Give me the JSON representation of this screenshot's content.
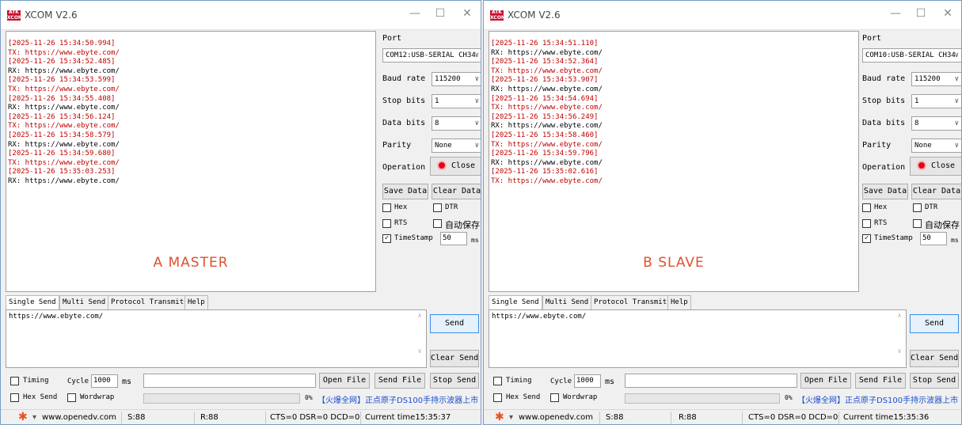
{
  "windows": [
    {
      "id": "A",
      "title": "XCOM V2.6",
      "logo_text": "ATK\nXCOM",
      "big_label": "A  MASTER",
      "log": [
        {
          "text": "[2025-11-26 15:34:50.994]",
          "color": "red"
        },
        {
          "text": "TX: https://www.ebyte.com/",
          "color": "red"
        },
        {
          "text": "[2025-11-26 15:34:52.485]",
          "color": "red"
        },
        {
          "text": "RX: https://www.ebyte.com/",
          "color": "black"
        },
        {
          "text": "[2025-11-26 15:34:53.599]",
          "color": "red"
        },
        {
          "text": "TX: https://www.ebyte.com/",
          "color": "red"
        },
        {
          "text": "[2025-11-26 15:34:55.408]",
          "color": "red"
        },
        {
          "text": "RX: https://www.ebyte.com/",
          "color": "black"
        },
        {
          "text": "[2025-11-26 15:34:56.124]",
          "color": "red"
        },
        {
          "text": "TX: https://www.ebyte.com/",
          "color": "red"
        },
        {
          "text": "[2025-11-26 15:34:58.579]",
          "color": "red"
        },
        {
          "text": "RX: https://www.ebyte.com/",
          "color": "black"
        },
        {
          "text": "[2025-11-26 15:34:59.680]",
          "color": "red"
        },
        {
          "text": "TX: https://www.ebyte.com/",
          "color": "red"
        },
        {
          "text": "[2025-11-26 15:35:03.253]",
          "color": "red"
        },
        {
          "text": "RX: https://www.ebyte.com/",
          "color": "black"
        }
      ],
      "port_label": "Port",
      "port_value": "COM12:USB-SERIAL CH34",
      "baud_label": "Baud rate",
      "baud_value": "115200",
      "stop_label": "Stop bits",
      "stop_value": "1",
      "data_label": "Data bits",
      "data_value": "8",
      "parity_label": "Parity",
      "parity_value": "None",
      "operation_label": "Operation",
      "operation_button": "Close",
      "save_data": "Save Data",
      "clear_data": "Clear Data",
      "hex_label": "Hex",
      "dtr_label": "DTR",
      "rts_label": "RTS",
      "autosave_label": "自动保存",
      "timestamp_label": "TimeStamp",
      "timestamp_checked": true,
      "timestamp_value": "50",
      "timestamp_unit": "ms",
      "tabs": [
        "Single Send",
        "Multi Send",
        "Protocol Transmit",
        "Help"
      ],
      "send_text": "https://www.ebyte.com/",
      "send_button": "Send",
      "clear_send": "Clear Send",
      "timing_label": "Timing",
      "cycle_label": "Cycle",
      "cycle_value": "1000",
      "cycle_unit": "ms",
      "open_file": "Open File",
      "send_file": "Send File",
      "stop_send": "Stop Send",
      "hex_send": "Hex Send",
      "wordwrap": "Wordwrap",
      "progress_text": "0%",
      "ad_text": "【火爆全网】正点原子DS100手持示波器上市",
      "status": {
        "url": "www.openedv.com",
        "s": "S:88",
        "r": "R:88",
        "lines": "CTS=0 DSR=0 DCD=0",
        "time": "Current time15:35:37"
      }
    },
    {
      "id": "B",
      "title": "XCOM V2.6",
      "logo_text": "ATK\nXCOM",
      "big_label": "B  SLAVE",
      "log": [
        {
          "text": "[2025-11-26 15:34:51.110]",
          "color": "red"
        },
        {
          "text": "RX: https://www.ebyte.com/",
          "color": "black"
        },
        {
          "text": "[2025-11-26 15:34:52.364]",
          "color": "red"
        },
        {
          "text": "TX: https://www.ebyte.com/",
          "color": "red"
        },
        {
          "text": "[2025-11-26 15:34:53.907]",
          "color": "red"
        },
        {
          "text": "RX: https://www.ebyte.com/",
          "color": "black"
        },
        {
          "text": "[2025-11-26 15:34:54.694]",
          "color": "red"
        },
        {
          "text": "TX: https://www.ebyte.com/",
          "color": "red"
        },
        {
          "text": "[2025-11-26 15:34:56.249]",
          "color": "red"
        },
        {
          "text": "RX: https://www.ebyte.com/",
          "color": "black"
        },
        {
          "text": "[2025-11-26 15:34:58.460]",
          "color": "red"
        },
        {
          "text": "TX: https://www.ebyte.com/",
          "color": "red"
        },
        {
          "text": "[2025-11-26 15:34:59.796]",
          "color": "red"
        },
        {
          "text": "RX: https://www.ebyte.com/",
          "color": "black"
        },
        {
          "text": "[2025-11-26 15:35:02.616]",
          "color": "red"
        },
        {
          "text": "TX: https://www.ebyte.com/",
          "color": "red"
        }
      ],
      "port_label": "Port",
      "port_value": "COM10:USB-SERIAL CH34",
      "baud_label": "Baud rate",
      "baud_value": "115200",
      "stop_label": "Stop bits",
      "stop_value": "1",
      "data_label": "Data bits",
      "data_value": "8",
      "parity_label": "Parity",
      "parity_value": "None",
      "operation_label": "Operation",
      "operation_button": "Close",
      "save_data": "Save Data",
      "clear_data": "Clear Data",
      "hex_label": "Hex",
      "dtr_label": "DTR",
      "rts_label": "RTS",
      "autosave_label": "自动保存",
      "timestamp_label": "TimeStamp",
      "timestamp_checked": true,
      "timestamp_value": "50",
      "timestamp_unit": "ms",
      "tabs": [
        "Single Send",
        "Multi Send",
        "Protocol Transmit",
        "Help"
      ],
      "send_text": "https://www.ebyte.com/",
      "send_button": "Send",
      "clear_send": "Clear Send",
      "timing_label": "Timing",
      "cycle_label": "Cycle",
      "cycle_value": "1000",
      "cycle_unit": "ms",
      "open_file": "Open File",
      "send_file": "Send File",
      "stop_send": "Stop Send",
      "hex_send": "Hex Send",
      "wordwrap": "Wordwrap",
      "progress_text": "0%",
      "ad_text": "【火爆全网】正点原子DS100手持示波器上市",
      "status": {
        "url": "www.openedv.com",
        "s": "S:88",
        "r": "R:88",
        "lines": "CTS=0 DSR=0 DCD=0",
        "time": "Current time15:35:36"
      }
    }
  ],
  "colors": {
    "red_text": "#c00000",
    "ad_blue": "#1a4fd0",
    "big_label": "#e05030",
    "close_dot": "#e8001c"
  }
}
